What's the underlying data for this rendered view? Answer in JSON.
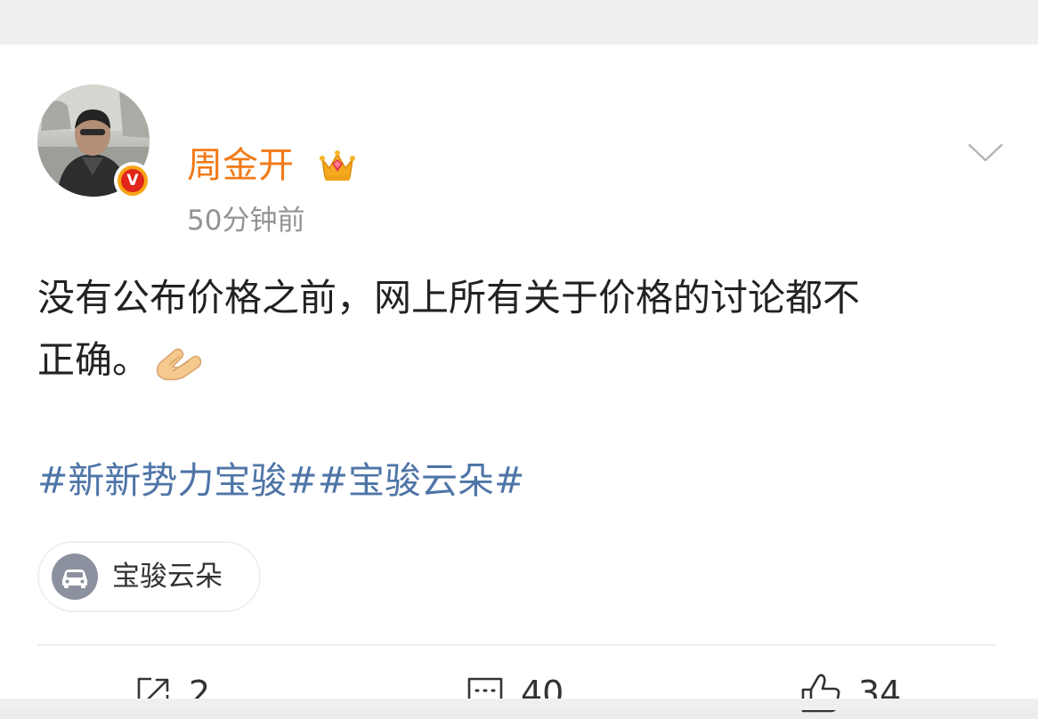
{
  "colors": {
    "page_background": "#efefef",
    "card_background": "#ffffff",
    "username": "#f27a18",
    "hashtag": "#4f75a7",
    "timestamp": "#939393",
    "verified_badge": "#e1251b"
  },
  "post": {
    "author": {
      "name": "周金开",
      "avatar_icon": "avatar",
      "member_badge_icon": "crown-icon",
      "verified_badge_letter": "V"
    },
    "timestamp": "50分钟前",
    "text_line_1": "没有公布价格之前，网上所有关于价格的讨论都不",
    "text_line_2": "正确。",
    "emoji": "hands-emoji-icon",
    "hashtags": "#新新势力宝骏##宝骏云朵#",
    "topic_chip": {
      "icon": "car-icon",
      "label": "宝骏云朵"
    },
    "menu_icon": "chevron-down-icon"
  },
  "actions": {
    "repost": {
      "icon": "repost-icon",
      "count": "2"
    },
    "comment": {
      "icon": "comment-icon",
      "count": "40"
    },
    "like": {
      "icon": "thumbs-up-icon",
      "count": "34"
    }
  }
}
